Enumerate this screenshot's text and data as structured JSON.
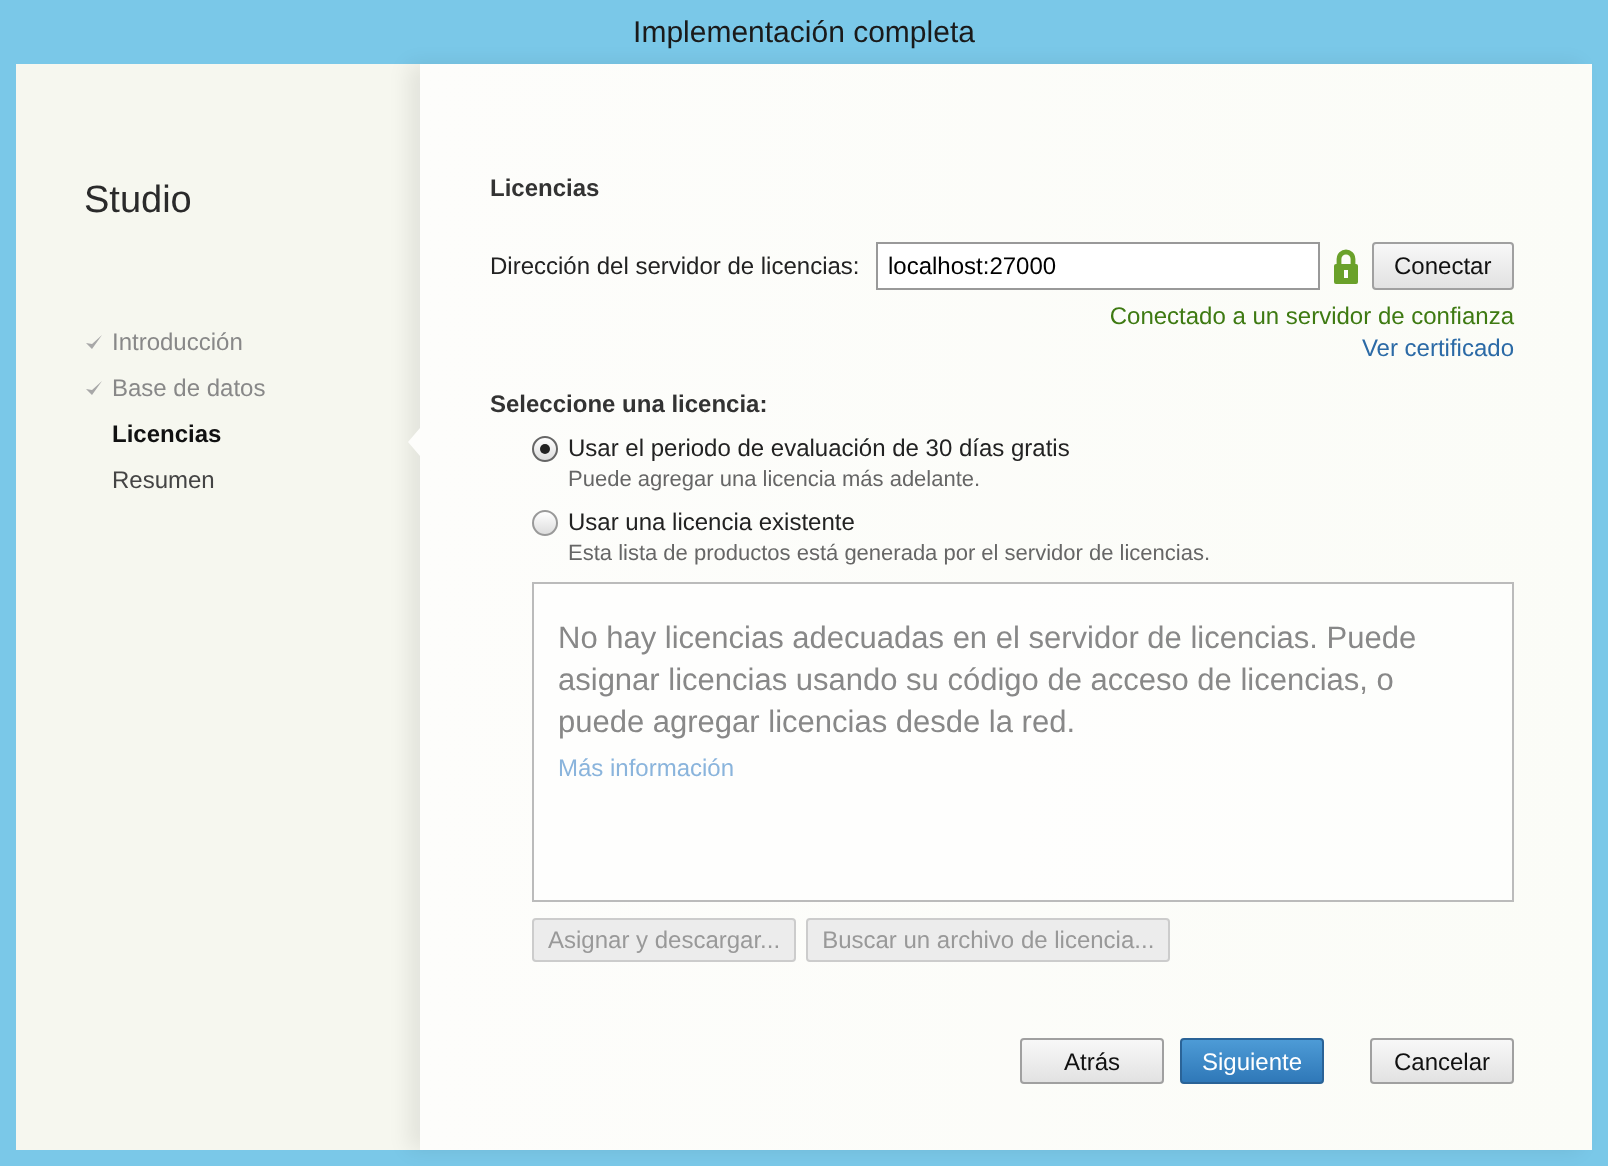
{
  "window": {
    "title": "Implementación completa"
  },
  "sidebar": {
    "title": "Studio",
    "steps": [
      {
        "label": "Introducción",
        "done": true,
        "selected": false
      },
      {
        "label": "Base de datos",
        "done": true,
        "selected": false
      },
      {
        "label": "Licencias",
        "done": false,
        "selected": true
      },
      {
        "label": "Resumen",
        "done": false,
        "selected": false
      }
    ]
  },
  "page": {
    "heading": "Licencias",
    "server_label": "Dirección del servidor de licencias:",
    "server_value": "localhost:27000",
    "connect_button": "Conectar",
    "status": "Conectado a un servidor de confianza",
    "certificate_link": "Ver certificado",
    "select_label": "Seleccione una licencia:",
    "options": [
      {
        "label": "Usar el periodo de evaluación de 30 días gratis",
        "hint": "Puede agregar una licencia más adelante.",
        "selected": true
      },
      {
        "label": "Usar una licencia existente",
        "hint": "Esta lista de productos está generada por el servidor de licencias.",
        "selected": false
      }
    ],
    "list_message": "No hay licencias adecuadas en el servidor de licencias. Puede asignar licencias usando su código de acceso de licencias, o puede agregar licencias desde la red.",
    "list_link": "Más información",
    "list_buttons": [
      {
        "label": "Asignar y descargar...",
        "disabled": true
      },
      {
        "label": "Buscar un archivo de licencia...",
        "disabled": true
      }
    ]
  },
  "footer_buttons": [
    {
      "label": "Atrás",
      "kind": "normal"
    },
    {
      "label": "Siguiente",
      "kind": "primary"
    },
    {
      "label": "Cancelar",
      "kind": "normal"
    }
  ]
}
